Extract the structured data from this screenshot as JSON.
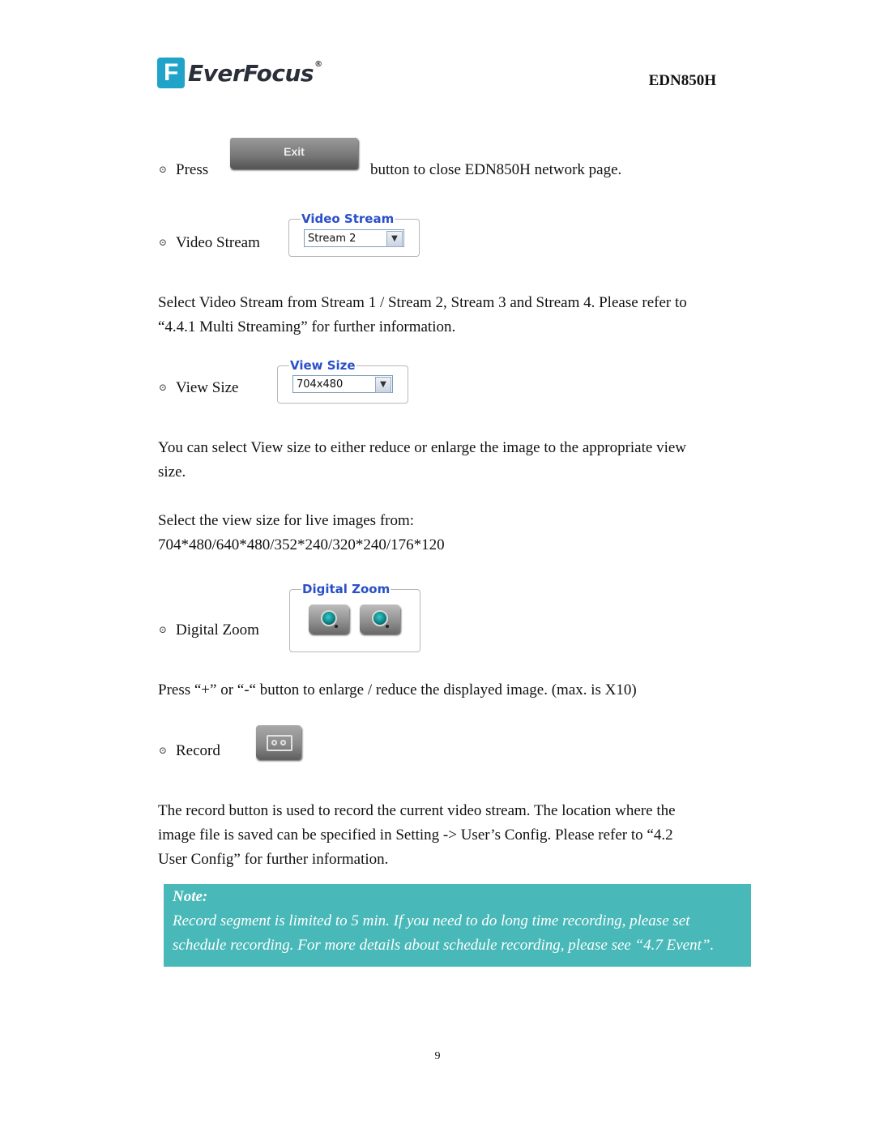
{
  "header": {
    "brand": "EverFocus",
    "brand_mark": "F",
    "registered": "®",
    "model": "EDN850H"
  },
  "exit_item": {
    "bullet": "⊙",
    "prefix": "Press",
    "button_label": "Exit",
    "suffix": "button to close EDN850H network page."
  },
  "video_stream": {
    "bullet": "⊙",
    "label": "Video Stream",
    "group_title": "Video Stream",
    "selected": "Stream 2",
    "description": [
      "Select Video Stream from Stream 1 / Stream 2, Stream 3 and Stream 4. Please refer to",
      "“4.4.1 Multi Streaming” for further information."
    ]
  },
  "view_size": {
    "bullet": "⊙",
    "label": "View Size",
    "group_title": "View Size",
    "selected": "704x480",
    "description": [
      "You can select View size to either reduce or enlarge the image to the appropriate view",
      "size."
    ],
    "options_intro": "Select the view size for live images from:",
    "options_list": "704*480/640*480/352*240/320*240/176*120"
  },
  "digital_zoom": {
    "bullet": "⊙",
    "label": "Digital Zoom",
    "group_title": "Digital Zoom",
    "zoom_in_icon": "zoom-in-icon",
    "zoom_out_icon": "zoom-out-icon",
    "description": "Press “+” or “-“ button to enlarge / reduce the displayed image. (max. is X10)"
  },
  "record": {
    "bullet": "⊙",
    "label": "Record",
    "icon": "cassette-record-icon",
    "description": [
      "The record button is used to record the current video stream. The location where the",
      "image file is saved can be specified in Setting -> User’s Config. Please refer to “4.2",
      "User Config” for further information."
    ]
  },
  "note": {
    "title": "Note:",
    "lines": [
      "Record segment is limited to 5 min. If you need to do long time recording, please set",
      "schedule recording. For more details about schedule recording, please see “4.7 Event”."
    ],
    "background_color": "#48b8b8"
  },
  "footer": {
    "page_number": "9"
  }
}
